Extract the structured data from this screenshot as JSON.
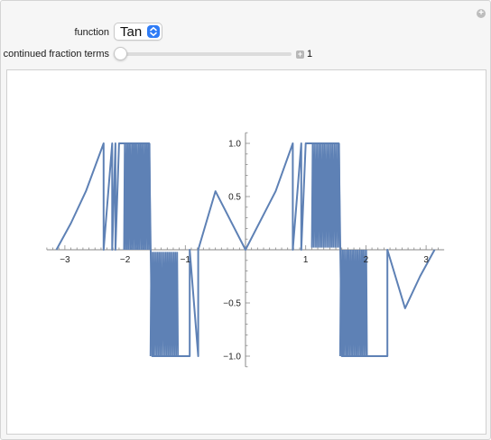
{
  "controls": {
    "function_label": "function",
    "function_value": "Tan",
    "terms_label": "continued fraction terms",
    "terms_value": "1",
    "terms_fraction": 0.0
  },
  "plot": {
    "x_ticks": [
      "−3",
      "−2",
      "−1",
      "1",
      "2",
      "3"
    ],
    "y_ticks": [
      "1.0",
      "0.5",
      "−0.5",
      "−1.0"
    ],
    "line_color": "#5e81b5"
  },
  "chart_data": {
    "type": "line",
    "title": "",
    "xlabel": "",
    "ylabel": "",
    "xlim": [
      -3.3,
      3.3
    ],
    "ylim": [
      -1.1,
      1.1
    ],
    "grid": false,
    "series": [
      {
        "values": [
          [
            -3.14159,
            0.0
          ],
          [
            -2.9,
            0.25
          ],
          [
            -2.65,
            0.55
          ],
          [
            -2.35619,
            1.0
          ],
          [
            -2.35619,
            0.0
          ],
          [
            -2.214,
            1.0
          ],
          [
            -2.214,
            0.0
          ],
          [
            -2.16,
            1.0
          ],
          [
            -2.16,
            0.0
          ],
          [
            -2.1,
            1.0
          ],
          [
            -2.0,
            1.0
          ],
          [
            -1.9,
            1.0
          ],
          [
            -1.8,
            1.0
          ],
          [
            -1.7,
            1.0
          ],
          [
            -1.6,
            1.0
          ],
          [
            -1.55,
            -1.0
          ],
          [
            -1.45,
            -1.0
          ],
          [
            -1.35,
            -1.0
          ],
          [
            -1.25,
            -1.0
          ],
          [
            -1.1,
            -1.0
          ],
          [
            -1.0,
            -1.0
          ],
          [
            -0.927,
            -1.0
          ],
          [
            -0.927,
            0.0
          ],
          [
            -0.785,
            -1.0
          ],
          [
            -0.785,
            0.0
          ],
          [
            -0.5,
            0.55
          ],
          [
            0.0,
            0.0
          ],
          [
            0.5,
            0.55
          ],
          [
            0.785,
            1.0
          ],
          [
            0.785,
            0.0
          ],
          [
            0.927,
            1.0
          ],
          [
            0.927,
            0.0
          ],
          [
            1.0,
            1.0
          ],
          [
            1.1,
            1.0
          ],
          [
            1.25,
            1.0
          ],
          [
            1.35,
            1.0
          ],
          [
            1.45,
            1.0
          ],
          [
            1.55,
            1.0
          ],
          [
            1.6,
            -1.0
          ],
          [
            1.7,
            -1.0
          ],
          [
            1.8,
            -1.0
          ],
          [
            1.9,
            -1.0
          ],
          [
            2.0,
            -1.0
          ],
          [
            2.16,
            -1.0
          ],
          [
            2.214,
            -1.0
          ],
          [
            2.35619,
            -1.0
          ],
          [
            2.35619,
            0.0
          ],
          [
            2.65,
            -0.55
          ],
          [
            2.9,
            -0.25
          ],
          [
            3.14159,
            0.0
          ]
        ]
      }
    ]
  }
}
